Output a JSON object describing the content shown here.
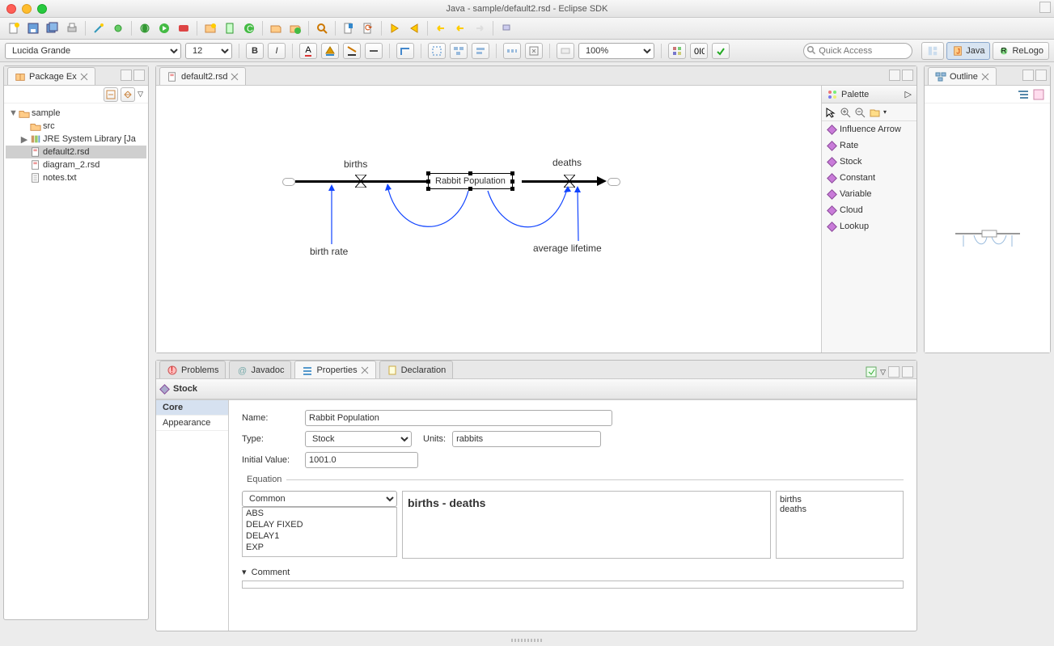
{
  "window": {
    "title": "Java - sample/default2.rsd - Eclipse SDK"
  },
  "toolbar2": {
    "font": "Lucida Grande",
    "size": "12",
    "zoom": "100%",
    "quick_ph": "Quick Access"
  },
  "perspectives": [
    {
      "label": "Java"
    },
    {
      "label": "ReLogo"
    }
  ],
  "packageExplorer": {
    "title": "Package Ex",
    "items": {
      "root": "sample",
      "src": "src",
      "jre": "JRE System Library [Ja",
      "f1": "default2.rsd",
      "f2": "diagram_2.rsd",
      "f3": "notes.txt"
    }
  },
  "editor": {
    "tab": "default2.rsd",
    "diagram": {
      "stock": "Rabbit Population",
      "births": "births",
      "deaths": "deaths",
      "birthrate": "birth rate",
      "avg": "average lifetime"
    },
    "palette": {
      "title": "Palette",
      "items": [
        "Influence Arrow",
        "Rate",
        "Stock",
        "Constant",
        "Variable",
        "Cloud",
        "Lookup"
      ]
    }
  },
  "outline": {
    "title": "Outline"
  },
  "bottomTabs": {
    "problems": "Problems",
    "javadoc": "Javadoc",
    "properties": "Properties",
    "declaration": "Declaration"
  },
  "properties": {
    "heading": "Stock",
    "side": {
      "core": "Core",
      "appearance": "Appearance"
    },
    "name_lbl": "Name:",
    "name": "Rabbit Population",
    "type_lbl": "Type:",
    "type": "Stock",
    "units_lbl": "Units:",
    "units": "rabbits",
    "init_lbl": "Initial Value:",
    "init": "1001.0",
    "eq_lbl": "Equation",
    "eq": "births - deaths",
    "fngroup": "Common",
    "fns": [
      "ABS",
      "DELAY FIXED",
      "DELAY1",
      "EXP"
    ],
    "vars": [
      "births",
      "deaths"
    ],
    "comment_lbl": "Comment"
  }
}
